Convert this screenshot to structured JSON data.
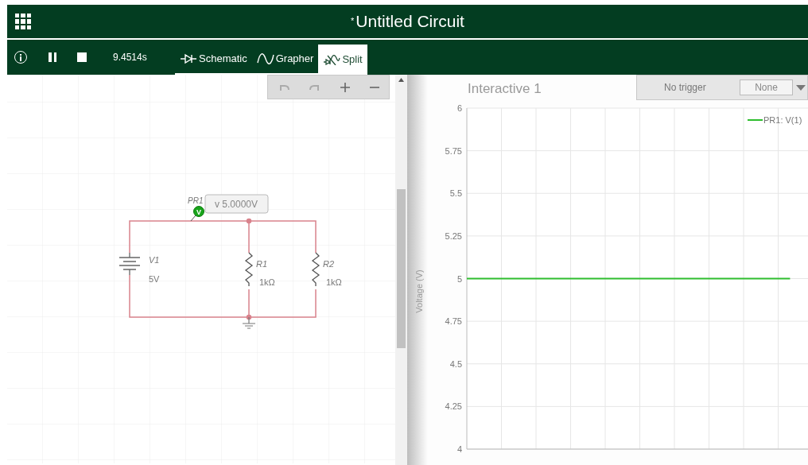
{
  "header": {
    "title_mark": "*",
    "title": "Untitled Circuit"
  },
  "toolbar": {
    "time": "9.4514s",
    "tabs": [
      {
        "label": "Schematic",
        "kind": "schematic",
        "selected": false
      },
      {
        "label": "Grapher",
        "kind": "grapher",
        "selected": false
      },
      {
        "label": "Split",
        "kind": "split",
        "selected": true
      }
    ]
  },
  "schematic": {
    "probe": {
      "name": "PR1",
      "marker": "V",
      "reading": "v 5.0000V"
    },
    "components": [
      {
        "kind": "battery",
        "name": "V1",
        "value": "5V"
      },
      {
        "kind": "resistor",
        "name": "R1",
        "value": "1kΩ"
      },
      {
        "kind": "resistor",
        "name": "R2",
        "value": "1kΩ"
      }
    ]
  },
  "graph": {
    "title": "Interactive 1",
    "trigger_label": "No trigger",
    "trigger_value": "None",
    "chart_data": {
      "type": "line",
      "grid": true,
      "ylabel": "Voltage (V)",
      "ylim": [
        4,
        6
      ],
      "yticks": [
        4,
        4.25,
        4.5,
        4.75,
        5,
        5.25,
        5.5,
        5.75,
        6
      ],
      "series": [
        {
          "name": "PR1: V(1)",
          "color": "#2ebd2e",
          "values": [
            5,
            5,
            5,
            5,
            5,
            5,
            5,
            5,
            5,
            5,
            5,
            5,
            5,
            5,
            5,
            5,
            5,
            5,
            5,
            null
          ]
        }
      ]
    }
  }
}
